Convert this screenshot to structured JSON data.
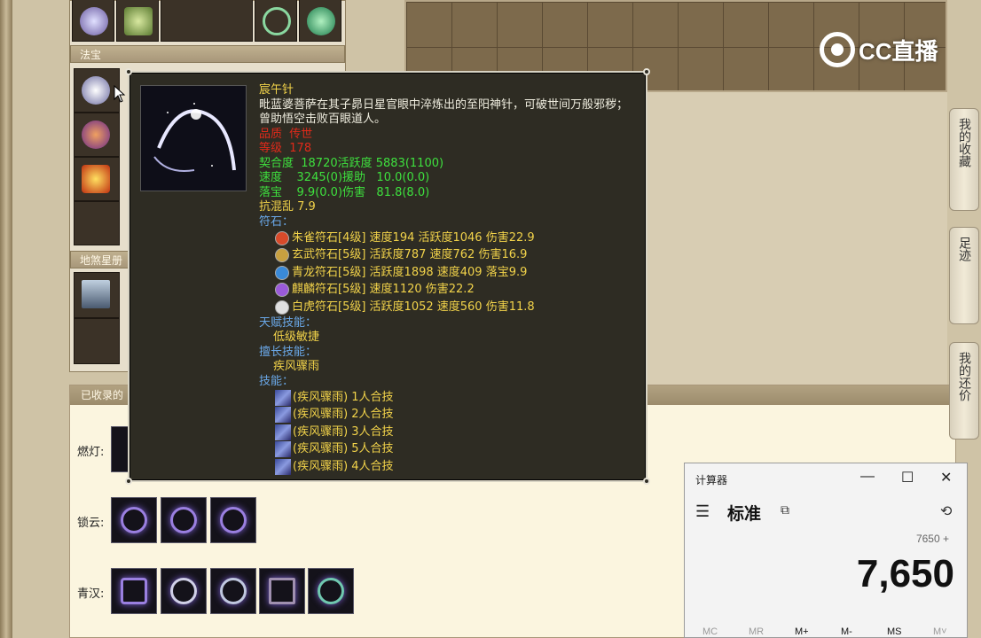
{
  "game": {
    "left_panel": {
      "section_fabao": "法宝",
      "section_dishaxing": "地煞星册"
    },
    "collect": {
      "header": "已收录的",
      "rows": [
        {
          "label": "燃灯:"
        },
        {
          "label": "锁云:"
        },
        {
          "label": "青汉:"
        }
      ]
    },
    "side_tabs": [
      {
        "label": "我的收藏"
      },
      {
        "label": "足迹"
      },
      {
        "label": "我的还价"
      }
    ]
  },
  "watermark": {
    "text": "CC直播"
  },
  "tooltip": {
    "name": "宸午针",
    "desc": "毗蓝婆菩萨在其子昴日星官眼中淬炼出的至阳神针，可破世间万般邪秽；曾助悟空击败百眼道人。",
    "quality_label": "品质",
    "quality_value": "传世",
    "level_label": "等级",
    "level_value": "178",
    "stats": [
      "契合度  18720活跃度 5883(1100)",
      "速度    3245(0)援助   10.0(0.0)",
      "落宝    9.9(0.0)伤害   81.8(8.0)"
    ],
    "resist": "抗混乱 7.9",
    "runes_label": "符石：",
    "runes": [
      {
        "text": "朱雀符石[4级] 速度194 活跃度1046 伤害22.9",
        "color": "#d84a2a"
      },
      {
        "text": "玄武符石[5级] 活跃度787 速度762 伤害16.9",
        "color": "#c8a040"
      },
      {
        "text": "青龙符石[5级] 活跃度1898 速度409 落宝9.9",
        "color": "#3a8ad8"
      },
      {
        "text": "麒麟符石[5级] 速度1120 伤害22.2",
        "color": "#9a5ad8"
      },
      {
        "text": "白虎符石[5级] 活跃度1052 速度560 伤害11.8",
        "color": "#e0e0e0"
      }
    ],
    "talent_label": "天赋技能：",
    "talent_value": "低级敏捷",
    "special_label": "擅长技能：",
    "special_value": "疾风骤雨",
    "skills_label": "技能：",
    "skills": [
      "(疾风骤雨) 1人合技",
      "(疾风骤雨) 2人合技",
      "(疾风骤雨) 3人合技",
      "(疾风骤雨) 5人合技",
      "(疾风骤雨) 4人合技"
    ]
  },
  "calculator": {
    "title": "计算器",
    "mode": "标准",
    "expression": "7650 +",
    "result": "7,650",
    "memory_buttons": [
      "MC",
      "MR",
      "M+",
      "M-",
      "MS",
      "M˅"
    ]
  }
}
